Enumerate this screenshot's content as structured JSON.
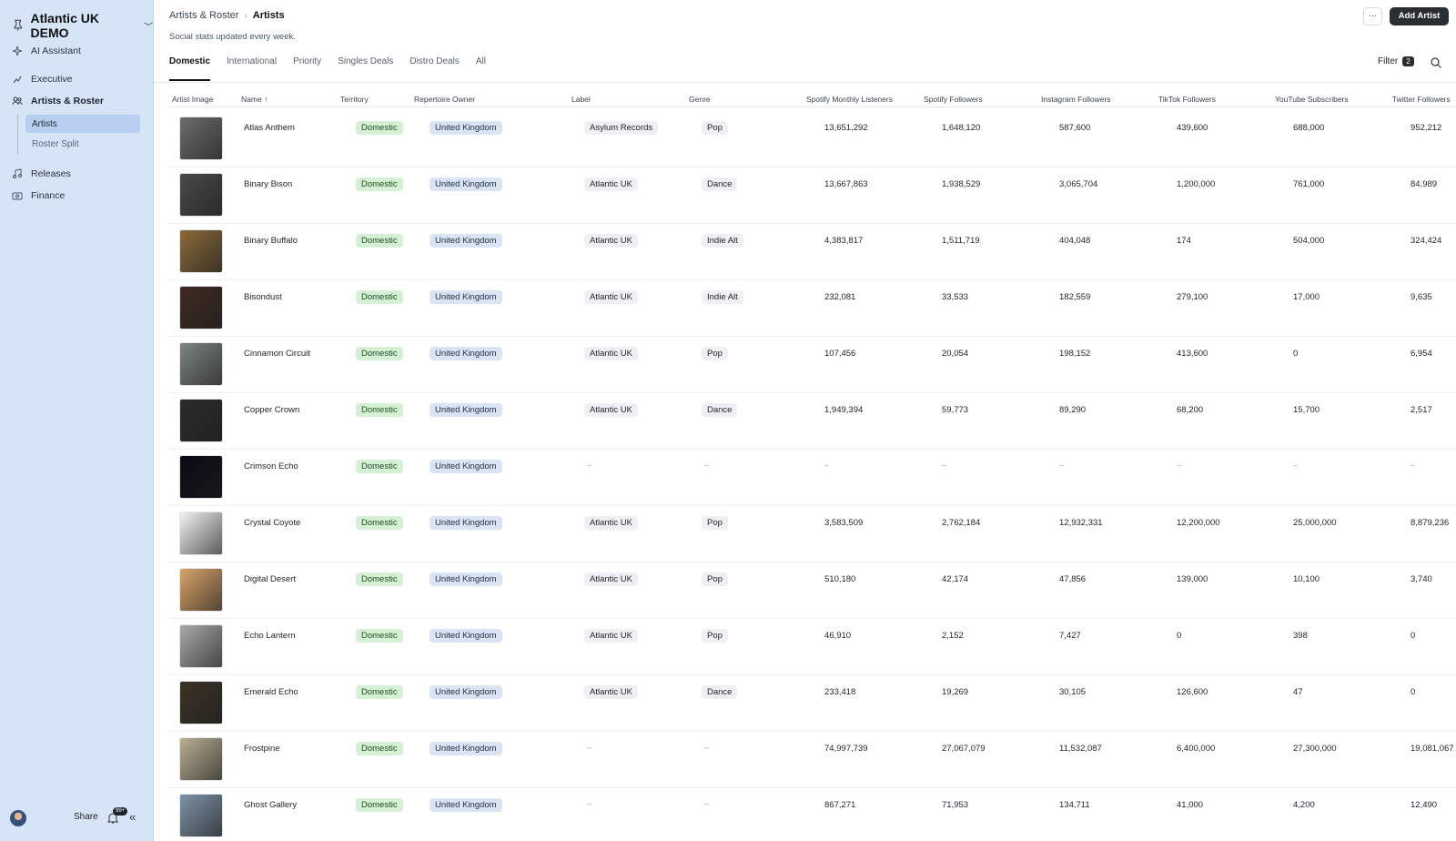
{
  "sidebar": {
    "workspace": "Atlantic UK DEMO",
    "nav": {
      "ai": "AI Assistant",
      "executive": "Executive",
      "artists_roster": "Artists & Roster",
      "artists": "Artists",
      "roster_split": "Roster Split",
      "releases": "Releases",
      "finance": "Finance"
    },
    "footer": {
      "share": "Share",
      "badge": "99+"
    }
  },
  "header": {
    "breadcrumb_parent": "Artists & Roster",
    "breadcrumb_current": "Artists",
    "subtitle": "Social stats updated every week.",
    "more": "···",
    "add_button": "Add Artist"
  },
  "tabs": [
    "Domestic",
    "International",
    "Priority",
    "Singles Deals",
    "Distro Deals",
    "All"
  ],
  "filter": {
    "label": "Filter",
    "count": "2"
  },
  "table": {
    "columns": {
      "image": "Artist Image",
      "name": "Name",
      "territory": "Territory",
      "owner": "Repertoire Owner",
      "label": "Label",
      "genre": "Genre",
      "sml": "Spotify Monthly Listeners",
      "sf": "Spotify Followers",
      "ig": "Instagram Followers",
      "tt": "TikTok Followers",
      "yt": "YouTube Subscribers",
      "tw": "Twitter Followers"
    },
    "rows": [
      {
        "name": "Atlas Anthem",
        "territory": "Domestic",
        "owner": "United Kingdom",
        "label": "Asylum Records",
        "genre": "Pop",
        "sml": "13,651,292",
        "sf": "1,648,120",
        "ig": "587,600",
        "tt": "439,600",
        "yt": "688,000",
        "tw": "952,212",
        "thumb": "#6d6d6d"
      },
      {
        "name": "Binary Bison",
        "territory": "Domestic",
        "owner": "United Kingdom",
        "label": "Atlantic UK",
        "genre": "Dance",
        "sml": "13,667,863",
        "sf": "1,938,529",
        "ig": "3,065,704",
        "tt": "1,200,000",
        "yt": "761,000",
        "tw": "84,989",
        "thumb": "#4a4a4a"
      },
      {
        "name": "Binary Buffalo",
        "territory": "Domestic",
        "owner": "United Kingdom",
        "label": "Atlantic UK",
        "genre": "Indie Alt",
        "sml": "4,383,817",
        "sf": "1,511,719",
        "ig": "404,048",
        "tt": "174",
        "yt": "504,000",
        "tw": "324,424",
        "thumb": "#8a6a3a"
      },
      {
        "name": "Bisondust",
        "territory": "Domestic",
        "owner": "United Kingdom",
        "label": "Atlantic UK",
        "genre": "Indie Alt",
        "sml": "232,081",
        "sf": "33,533",
        "ig": "182,559",
        "tt": "279,100",
        "yt": "17,000",
        "tw": "9,635",
        "thumb": "#3e2a22"
      },
      {
        "name": "Cinnamon Circuit",
        "territory": "Domestic",
        "owner": "United Kingdom",
        "label": "Atlantic UK",
        "genre": "Pop",
        "sml": "107,456",
        "sf": "20,054",
        "ig": "198,152",
        "tt": "413,600",
        "yt": "0",
        "tw": "6,954",
        "thumb": "#7d8580"
      },
      {
        "name": "Copper Crown",
        "territory": "Domestic",
        "owner": "United Kingdom",
        "label": "Atlantic UK",
        "genre": "Dance",
        "sml": "1,949,394",
        "sf": "59,773",
        "ig": "89,290",
        "tt": "68,200",
        "yt": "15,700",
        "tw": "2,517",
        "thumb": "#2b2b2b"
      },
      {
        "name": "Crimson Echo",
        "territory": "Domestic",
        "owner": "United Kingdom",
        "label": "–",
        "genre": "–",
        "sml": "–",
        "sf": "–",
        "ig": "–",
        "tt": "–",
        "yt": "–",
        "tw": "–",
        "thumb": "#0a0a14"
      },
      {
        "name": "Crystal Coyote",
        "territory": "Domestic",
        "owner": "United Kingdom",
        "label": "Atlantic UK",
        "genre": "Pop",
        "sml": "3,583,509",
        "sf": "2,762,184",
        "ig": "12,932,331",
        "tt": "12,200,000",
        "yt": "25,000,000",
        "tw": "8,879,236",
        "thumb": "#f3f3f3"
      },
      {
        "name": "Digital Desert",
        "territory": "Domestic",
        "owner": "United Kingdom",
        "label": "Atlantic UK",
        "genre": "Pop",
        "sml": "510,180",
        "sf": "42,174",
        "ig": "47,856",
        "tt": "139,000",
        "yt": "10,100",
        "tw": "3,740",
        "thumb": "#d9a46a"
      },
      {
        "name": "Echo Lantern",
        "territory": "Domestic",
        "owner": "United Kingdom",
        "label": "Atlantic UK",
        "genre": "Pop",
        "sml": "46,910",
        "sf": "2,152",
        "ig": "7,427",
        "tt": "0",
        "yt": "398",
        "tw": "0",
        "thumb": "#a9a9a9"
      },
      {
        "name": "Emerald Echo",
        "territory": "Domestic",
        "owner": "United Kingdom",
        "label": "Atlantic UK",
        "genre": "Dance",
        "sml": "233,418",
        "sf": "19,269",
        "ig": "30,105",
        "tt": "126,600",
        "yt": "47",
        "tw": "0",
        "thumb": "#3a3226"
      },
      {
        "name": "Frostpine",
        "territory": "Domestic",
        "owner": "United Kingdom",
        "label": "–",
        "genre": "–",
        "sml": "74,997,739",
        "sf": "27,067,079",
        "ig": "11,532,087",
        "tt": "6,400,000",
        "yt": "27,300,000",
        "tw": "19,081,067",
        "thumb": "#b9ae93"
      },
      {
        "name": "Ghost Gallery",
        "territory": "Domestic",
        "owner": "United Kingdom",
        "label": "–",
        "genre": "–",
        "sml": "867,271",
        "sf": "71,953",
        "ig": "134,711",
        "tt": "41,000",
        "yt": "4,200",
        "tw": "12,490",
        "thumb": "#7e93a7"
      }
    ]
  }
}
